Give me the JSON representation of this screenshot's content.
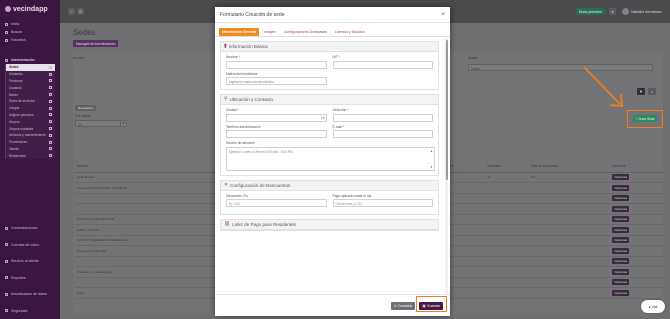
{
  "app": {
    "logo_text": "vecindapp"
  },
  "sidebar": {
    "top_items": [
      {
        "label": "Inicio",
        "icon": "home-icon"
      },
      {
        "label": "Buscar",
        "icon": "search-icon"
      },
      {
        "label": "Favoritos",
        "icon": "star-icon"
      }
    ],
    "section_label": "Administración",
    "sub_items": [
      "Sedes",
      "Unidades",
      "Personas",
      "Usuarios",
      "Naves",
      "Roles de servicios",
      "Cargos",
      "Asignar permisos",
      "Grupos",
      "Grupos unidades",
      "Artículos y mantenimiento",
      "Proveedores",
      "Tareas",
      "Residencial"
    ],
    "bottom_items": [
      "Comunicaciones",
      "Cuentas de cobro",
      "Servicio al cliente",
      "Reportes",
      "Actualización de datos",
      "Seguridad"
    ]
  },
  "topbar": {
    "green_button": "Modo premium",
    "user_name": "Nathalia Hernandez"
  },
  "page": {
    "title": "Sedes",
    "management_button": "Managed de Administración",
    "filter_label_left": "Nombre",
    "filter_label_right": "Estado",
    "filter_value_right": "Todos",
    "results_pill": "Resultados",
    "per_page_label": "Por página",
    "per_page_value": "10",
    "create_button": "Crear Sede",
    "table": {
      "headers": [
        "Nombre",
        "NIT",
        "Dirección",
        "Ciudad",
        "Teléfono",
        "Email",
        "Residentes",
        "Unidades",
        "Tasa de inscripción",
        "Acciones"
      ],
      "rows": [
        [
          "Sede Bogotá",
          "000000016",
          "",
          "",
          "",
          "",
          "1",
          "12",
          "0%",
          "Opciones"
        ],
        [
          "La Estancia das Cumbre de Selmas",
          "",
          "",
          "",
          "",
          "",
          "",
          "",
          "",
          "Opciones"
        ],
        [
          "",
          "0000001012321",
          "",
          "",
          "",
          "",
          "",
          "",
          "",
          "Opciones"
        ],
        [
          "",
          "",
          "",
          "",
          "",
          "",
          "",
          "",
          "",
          "Opciones"
        ],
        [
          "CONO ALTO ELURI ROSE",
          "00014040",
          "",
          "",
          "",
          "",
          "",
          "",
          "",
          "Opciones"
        ],
        [
          "Edificio Venecia",
          "0020022",
          "",
          "",
          "",
          "",
          "",
          "",
          "",
          "Opciones"
        ],
        [
          "CASAS Y EMPERIORE GENERALE",
          "0000 0413",
          "",
          "",
          "",
          "",
          "",
          "",
          "",
          "Opciones"
        ],
        [
          "Conjunto Residencial",
          "",
          "",
          "",
          "",
          "",
          "",
          "",
          "",
          "Opciones"
        ],
        [
          "",
          "",
          "",
          "",
          "",
          "",
          "",
          "",
          "",
          "Opciones"
        ],
        [
          "Plaza Arroyo Tecnológico",
          "",
          "",
          "",
          "",
          "",
          "",
          "",
          "",
          "Opciones"
        ],
        [
          "",
          "",
          "",
          "",
          "",
          "",
          "",
          "",
          "",
          "Opciones"
        ],
        [
          "Casa",
          "",
          "",
          "",
          "",
          "",
          "",
          "",
          "",
          "Opciones"
        ]
      ]
    }
  },
  "modal": {
    "title": "Formulario Creación de sede",
    "close_glyph": "×",
    "tabs": [
      "Información General",
      "Imagen",
      "Configuraciones Avanzadas",
      "Licencia y Módulos"
    ],
    "sections": {
      "basic": {
        "title": "Información Básica",
        "name_label": "Nombre *",
        "nit_label": "NIT *",
        "matricula_label": "Matrícula Inmobiliaria",
        "matricula_placeholder": "Ingrese la matrícula inmobiliaria"
      },
      "location": {
        "title": "Ubicación y Contacto",
        "city_label": "Ciudad *",
        "address_label": "Dirección *",
        "phone_label": "Teléfono administración",
        "email_label": "E-mail *",
        "hours_label": "Horario de atención",
        "hours_placeholder": "Ejemplo: Lunes a Viernes 8:00 AM - 5:00 PM"
      },
      "discounts": {
        "title": "Configuración de Descuentos",
        "discount_label": "Descuento (%)",
        "discount_placeholder": "Ej: 0.00",
        "pay_day_label": "Pago aplicado hasta el día",
        "pay_day_placeholder": "Día del mes (1-31)"
      },
      "links": {
        "title": "Links de Pago para Residentes"
      }
    },
    "cancel_button": "Cancelar",
    "save_button": "Guardar"
  },
  "chat_widget": {
    "label": "Vial"
  },
  "colors": {
    "brand": "#3a1740",
    "accent_orange": "#f08a1f",
    "save": "#4a1846",
    "create_green": "#2f8a5e",
    "annotation": "#f07f1c"
  }
}
